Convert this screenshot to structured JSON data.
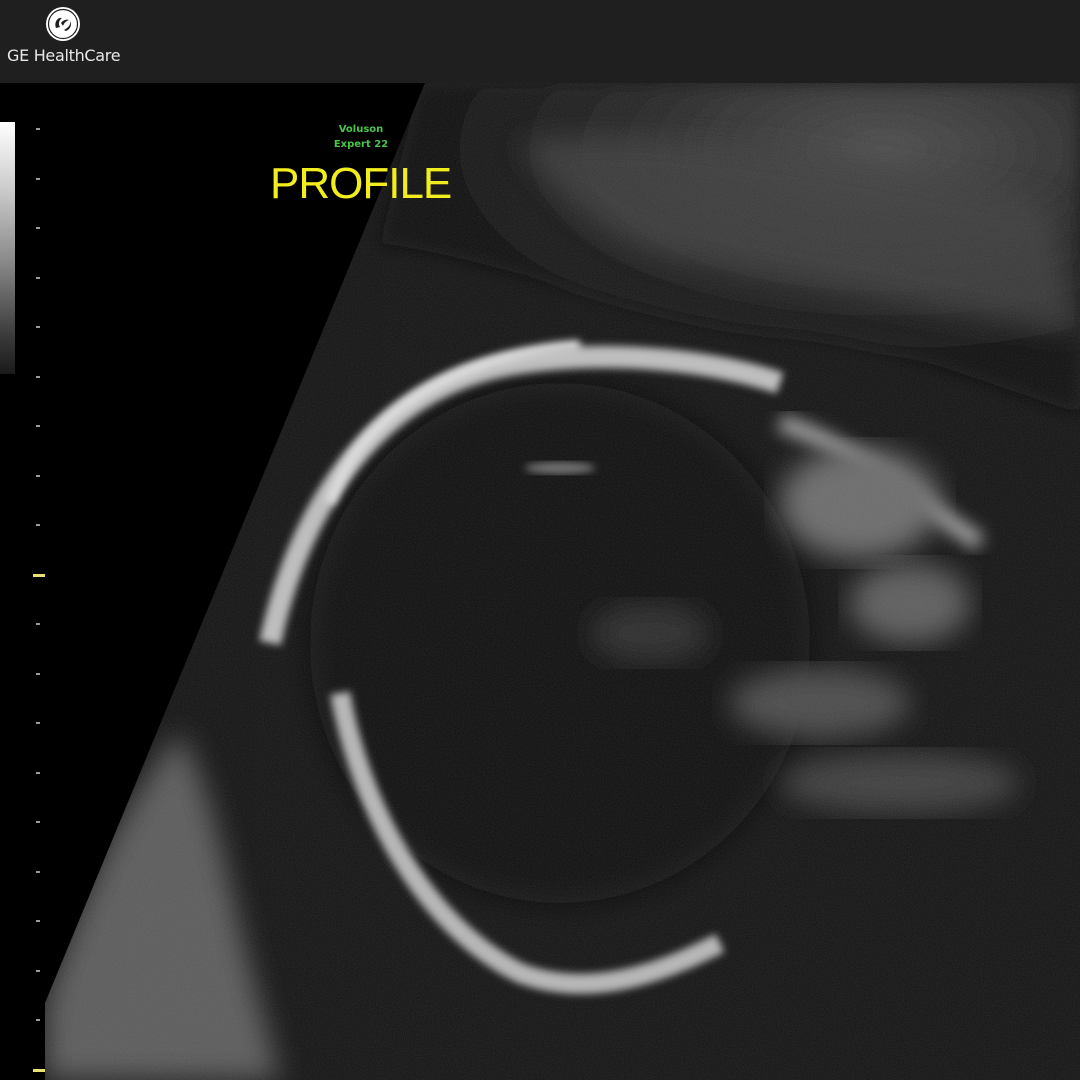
{
  "header": {
    "logo_icon": "ge-monogram-icon",
    "brand_name": "GE HealthCare"
  },
  "overlay": {
    "device_model_line1": "Voluson",
    "device_model_line2": "Expert 22",
    "view_label": "PROFILE",
    "view_label_color": "#f2ee1e",
    "device_text_color": "#4cc44c"
  },
  "scale": {
    "grayscale_bar": "grayscale-map-bar",
    "tick_count": 20,
    "major_tick_indices": [
      9,
      19
    ]
  },
  "colors": {
    "topbar": "#1f1f1f",
    "background": "#000000",
    "major_tick": "#e8e070"
  }
}
